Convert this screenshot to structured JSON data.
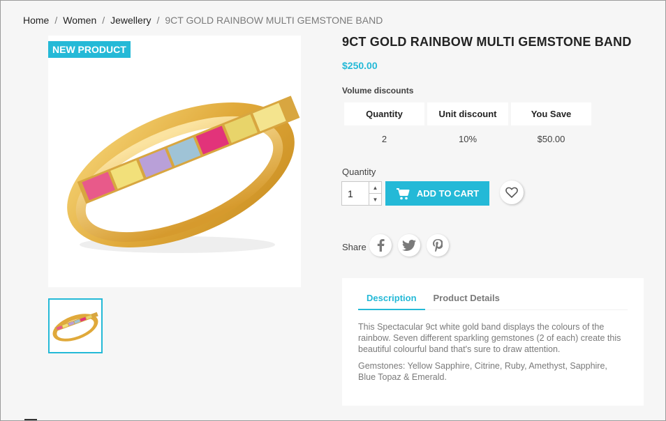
{
  "breadcrumb": {
    "items": [
      "Home",
      "Women",
      "Jewellery"
    ],
    "separator": "/",
    "current": "9CT GOLD RAINBOW MULTI GEMSTONE BAND"
  },
  "product": {
    "badge": "New product",
    "title": "9CT GOLD RAINBOW MULTI GEMSTONE BAND",
    "price": "$250.00",
    "image_subject": "gold band ring with rainbow princess-cut gemstones"
  },
  "volume_discounts": {
    "label": "Volume discounts",
    "headers": [
      "Quantity",
      "Unit discount",
      "You Save"
    ],
    "rows": [
      [
        "2",
        "10%",
        "$50.00"
      ]
    ]
  },
  "purchase": {
    "quantity_label": "Quantity",
    "quantity_value": "1",
    "add_to_cart": "Add to cart",
    "wishlist_icon": "heart-icon"
  },
  "share": {
    "label": "Share",
    "icons": [
      "facebook-icon",
      "twitter-icon",
      "pinterest-icon"
    ]
  },
  "tabs": {
    "items": [
      "Description",
      "Product Details"
    ],
    "active": "Description",
    "description": [
      "This Spectacular 9ct white gold band displays the colours of the rainbow. Seven different sparkling gemstones (2 of each) create this beautiful colourful band that's sure to draw attention.",
      "Gemstones: Yellow Sapphire, Citrine, Ruby, Amethyst, Sapphire, Blue Topaz & Emerald."
    ]
  },
  "colors": {
    "accent": "#24b9d7",
    "background": "#f6f6f6",
    "text": "#232323",
    "muted": "#7a7a7a"
  }
}
